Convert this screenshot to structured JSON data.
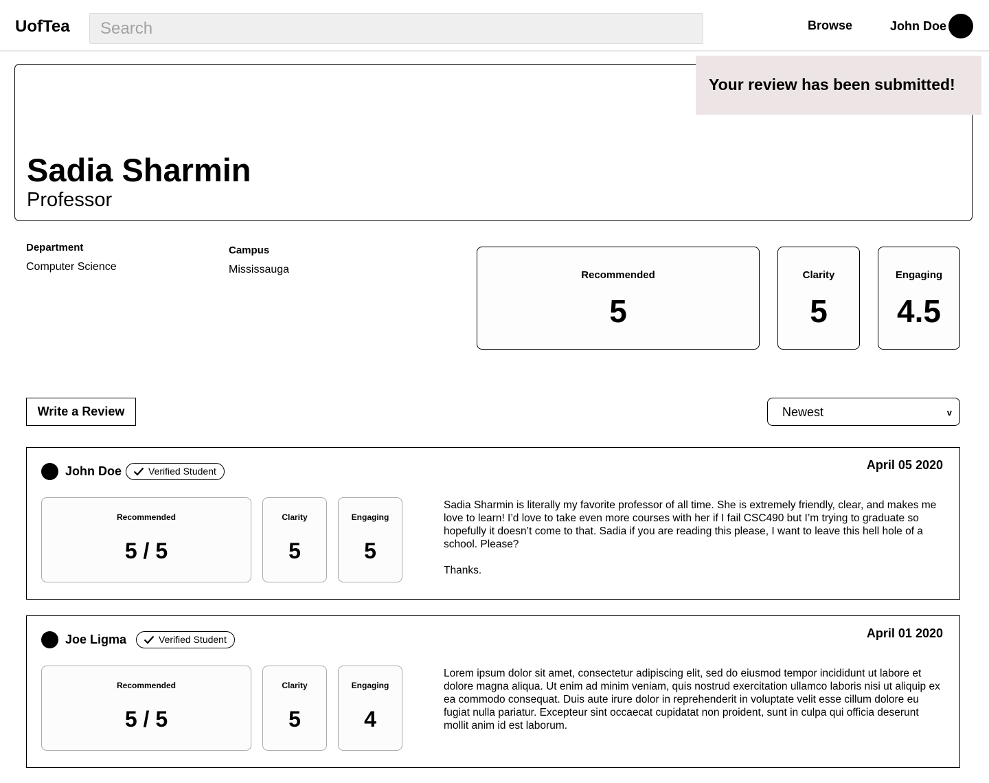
{
  "nav": {
    "logo": "UofTea",
    "search_placeholder": "Search",
    "browse": "Browse",
    "user_name": "John Doe"
  },
  "toast": "Your review has been submitted!",
  "professor": {
    "name": "Sadia Sharmin",
    "title": "Professor",
    "department_label": "Department",
    "department": "Computer Science",
    "campus_label": "Campus",
    "campus": "Mississauga"
  },
  "summary": {
    "recommended_label": "Recommended",
    "recommended": "5",
    "clarity_label": "Clarity",
    "clarity": "5",
    "engaging_label": "Engaging",
    "engaging": "4.5"
  },
  "controls": {
    "write_review": "Write a Review",
    "sort_selected": "Newest",
    "sort_chevron": "v"
  },
  "reviews": [
    {
      "author": "John Doe",
      "badge": "Verified Student",
      "date": "April 05 2020",
      "recommended_label": "Recommended",
      "recommended": "5 / 5",
      "clarity_label": "Clarity",
      "clarity": "5",
      "engaging_label": "Engaging",
      "engaging": "5",
      "paragraphs": [
        "Sadia Sharmin is literally my favorite professor of all time. She is extremely friendly, clear, and makes me love to learn! I’d love to take even more courses with her if I fail CSC490 but I’m trying to graduate so hopefully it doesn’t come to that. Sadia if you are reading this please, I want to leave this hell hole of a school. Please?",
        "Thanks."
      ]
    },
    {
      "author": "Joe Ligma",
      "badge": "Verified Student",
      "date": "April 01 2020",
      "recommended_label": "Recommended",
      "recommended": "5 / 5",
      "clarity_label": "Clarity",
      "clarity": "5",
      "engaging_label": "Engaging",
      "engaging": "4",
      "paragraphs": [
        "Lorem ipsum dolor sit amet, consectetur adipiscing elit, sed do eiusmod tempor incididunt ut labore et dolore magna aliqua. Ut enim ad minim veniam, quis nostrud exercitation ullamco laboris nisi ut aliquip ex ea commodo consequat. Duis aute irure dolor in reprehenderit in voluptate velit esse cillum dolore eu fugiat nulla pariatur. Excepteur sint occaecat cupidatat non proident, sunt in culpa qui officia deserunt mollit anim id est laborum."
      ]
    }
  ]
}
